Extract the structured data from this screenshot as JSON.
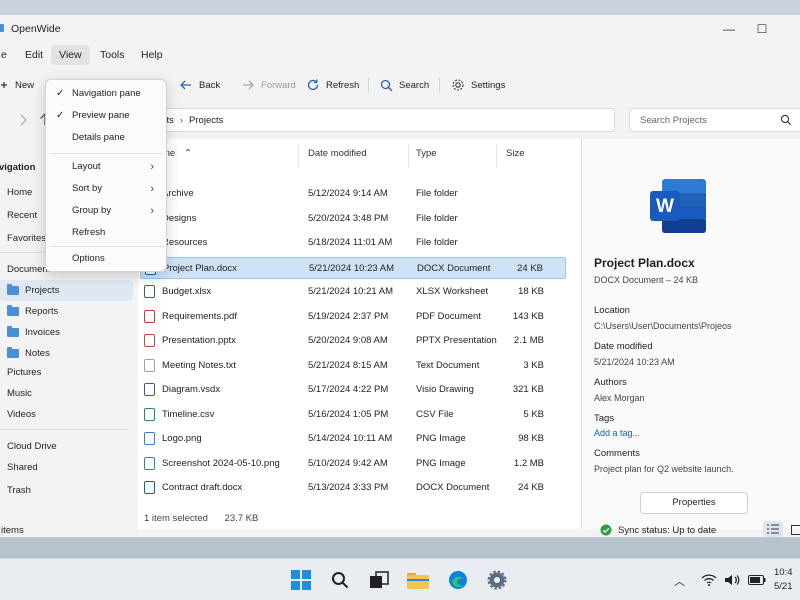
{
  "window": {
    "title": "OpenWide",
    "controls": {
      "minimize": "—",
      "maximize": "☐"
    }
  },
  "menubar": {
    "items": [
      "e",
      "Edit",
      "View",
      "Tools",
      "Help"
    ],
    "active": "View"
  },
  "toolbar": {
    "new_label": "New",
    "back_label": "Back",
    "forward_label": "Forward",
    "refresh_label": "Refresh",
    "search_label": "Search",
    "settings_label": "Settings"
  },
  "address": {
    "crumbs": [
      "ments",
      "Projects"
    ],
    "search_placeholder": "Search Projects"
  },
  "nav": {
    "header": "vigation",
    "items": [
      {
        "label": "Home"
      },
      {
        "label": "Recent"
      },
      {
        "label": "Favorites"
      },
      {
        "label": "Documents"
      },
      {
        "label": "Projects",
        "selected": true
      },
      {
        "label": "Reports"
      },
      {
        "label": "Invoices"
      },
      {
        "label": "Notes"
      },
      {
        "label": "Pictures"
      },
      {
        "label": "Music"
      },
      {
        "label": "Videos"
      },
      {
        "label": "Cloud Drive"
      },
      {
        "label": "Shared"
      },
      {
        "label": "Trash"
      }
    ]
  },
  "columns": {
    "name": "me",
    "date": "Date modified",
    "type": "Type",
    "size": "Size"
  },
  "files": [
    {
      "name": "Archive",
      "date": "5/12/2024 9:14 AM",
      "type": "File folder",
      "size": "",
      "kind": "folder"
    },
    {
      "name": "Designs",
      "date": "5/20/2024 3:48 PM",
      "type": "File folder",
      "size": "",
      "kind": "folder"
    },
    {
      "name": "Resources",
      "date": "5/18/2024 11:01 AM",
      "type": "File folder",
      "size": "",
      "kind": "folder"
    },
    {
      "name": "Project Plan.docx",
      "date": "5/21/2024 10:23 AM",
      "type": "DOCX Document",
      "size": "24 KB",
      "kind": "docx",
      "selected": true
    },
    {
      "name": "Budget.xlsx",
      "date": "5/21/2024 10:21 AM",
      "type": "XLSX Worksheet",
      "size": "18 KB",
      "kind": "xlsx"
    },
    {
      "name": "Requirements.pdf",
      "date": "5/19/2024 2:37 PM",
      "type": "PDF Document",
      "size": "143 KB",
      "kind": "pdf"
    },
    {
      "name": "Presentation.pptx",
      "date": "5/20/2024 9:08 AM",
      "type": "PPTX Presentation",
      "size": "2.1 MB",
      "kind": "pptx"
    },
    {
      "name": "Meeting Notes.txt",
      "date": "5/21/2024 8:15 AM",
      "type": "Text Document",
      "size": "3 KB",
      "kind": "txt"
    },
    {
      "name": "Diagram.vsdx",
      "date": "5/17/2024 4:22 PM",
      "type": "Visio Drawing",
      "size": "321 KB",
      "kind": "vsdx"
    },
    {
      "name": "Timeline.csv",
      "date": "5/16/2024 1:05 PM",
      "type": "CSV File",
      "size": "5 KB",
      "kind": "csv"
    },
    {
      "name": "Logo.png",
      "date": "5/14/2024 10:11 AM",
      "type": "PNG Image",
      "size": "98 KB",
      "kind": "png"
    },
    {
      "name": "Screenshot 2024-05-10.png",
      "date": "5/10/2024 9:42 AM",
      "type": "PNG Image",
      "size": "1.2 MB",
      "kind": "png"
    },
    {
      "name": "Contract draft.docx",
      "date": "5/13/2024 3:33 PM",
      "type": "DOCX Document",
      "size": "24 KB",
      "kind": "docx"
    }
  ],
  "selection_status": {
    "count": "1 item selected",
    "size": "23.7 KB"
  },
  "preview": {
    "icon_letter": "W",
    "filename": "Project Plan.docx",
    "subtitle": "DOCX Document – 24 KB",
    "location_label": "Location",
    "location_value": "C:\\Users\\User\\Documents\\Projeos",
    "modified_label": "Date modified",
    "modified_value": "5/21/2024 10:23 AM",
    "authors_label": "Authors",
    "authors_value": "Alex Morgan",
    "tags_label": "Tags",
    "tags_link": "Add a tag...",
    "comments_label": "Comments",
    "comments_value": "Project plan for Q2 website launch.",
    "properties_button": "Properties"
  },
  "statusbar": {
    "left": "items",
    "sync": "Sync status: Up to date"
  },
  "view_menu": {
    "items": [
      {
        "label": "Navigation pane",
        "checked": true
      },
      {
        "label": "Preview pane",
        "checked": true
      },
      {
        "label": "Details pane",
        "checked": false
      },
      {
        "label": "Layout",
        "submenu": true
      },
      {
        "label": "Sort by",
        "submenu": true
      },
      {
        "label": "Group by",
        "submenu": true
      },
      {
        "label": "Refresh"
      },
      {
        "label": "Options"
      }
    ]
  },
  "taskbar": {
    "clock_time": "10:4",
    "clock_date": "5/21"
  },
  "colors": {
    "accent": "#0067c0",
    "selection": "#cfe3f7",
    "sync_ok": "#2e9d44",
    "folder": "#e8b545"
  }
}
